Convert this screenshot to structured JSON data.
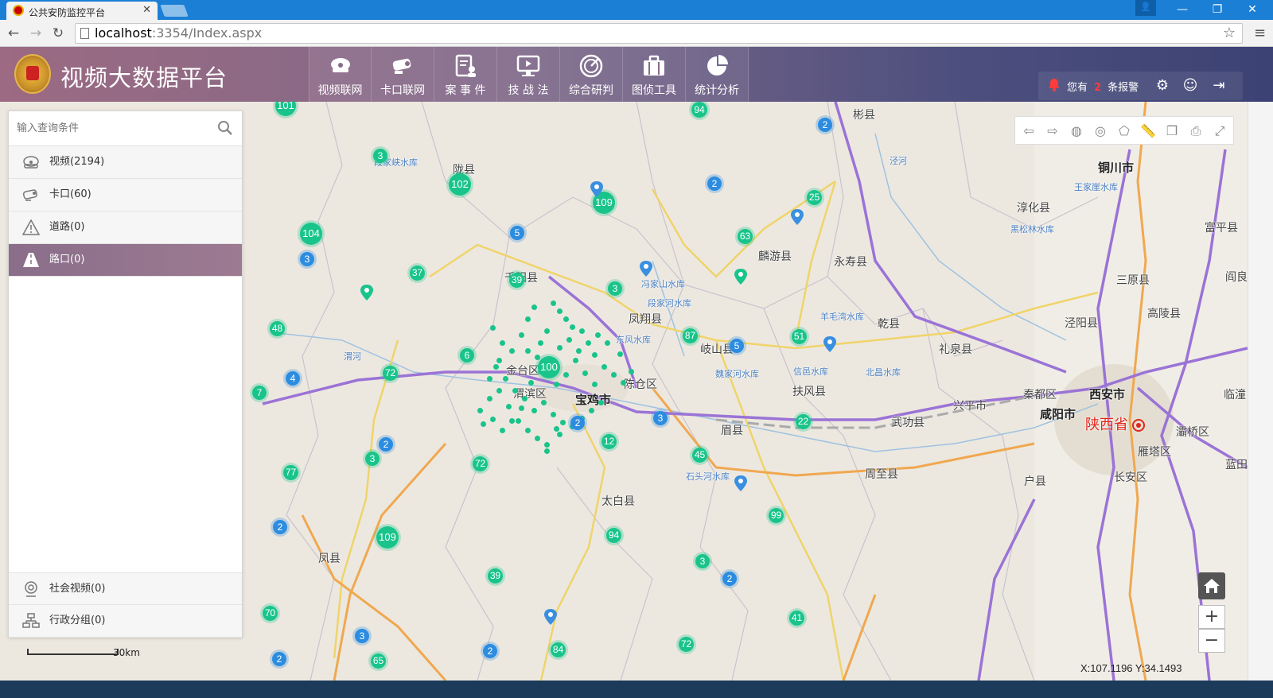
{
  "browser": {
    "tab_title": "公共安防监控平台",
    "url_host": "localhost",
    "url_rest": ":3354/Index.aspx"
  },
  "app": {
    "title": "视频大数据平台",
    "nav": [
      {
        "label": "视频联网",
        "icon": "camera-dome-icon"
      },
      {
        "label": "卡口联网",
        "icon": "bullet-camera-icon"
      },
      {
        "label": "案 事 件",
        "icon": "case-file-icon"
      },
      {
        "label": "技 战 法",
        "icon": "monitor-icon"
      },
      {
        "label": "综合研判",
        "icon": "target-icon"
      },
      {
        "label": "图侦工具",
        "icon": "briefcase-icon"
      },
      {
        "label": "统计分析",
        "icon": "pie-chart-icon"
      }
    ],
    "alert": {
      "prefix": "您有",
      "count": "2",
      "suffix": "条报警"
    }
  },
  "panel": {
    "search_placeholder": "输入查询条件",
    "items": [
      {
        "label": "视频(2194)",
        "icon": "camera-dome-icon"
      },
      {
        "label": "卡口(60)",
        "icon": "bullet-camera-icon"
      },
      {
        "label": "道路(0)",
        "icon": "road-warning-icon"
      },
      {
        "label": "路口(0)",
        "icon": "intersection-icon",
        "active": true
      }
    ],
    "bottom_items": [
      {
        "label": "社会视频(0)",
        "icon": "social-camera-icon"
      },
      {
        "label": "行政分组(0)",
        "icon": "org-tree-icon"
      }
    ]
  },
  "map": {
    "scale_label": "30km",
    "coords": "X:107.1196 Y:34.1493",
    "province_label": "陕西省",
    "place_labels": [
      "陇县",
      "千阳县",
      "宝鸡市",
      "金台区",
      "渭滨区",
      "陈仓区",
      "凤翔县",
      "岐山县",
      "扶风县",
      "眉县",
      "太白县",
      "凤县",
      "麟游县",
      "永寿县",
      "乾县",
      "礼泉县",
      "兴平市",
      "武功县",
      "周至县",
      "户县",
      "长安区",
      "雁塔区",
      "灞桥区",
      "西安市",
      "咸阳市",
      "泾阳县",
      "三原县",
      "高陵县",
      "淳化县",
      "铜川市",
      "富平县",
      "彬县",
      "秦都区",
      "阎良",
      "临潼",
      "蓝田"
    ],
    "water_labels": [
      "段家峡水库",
      "王家崖水库",
      "冯家山水库",
      "东风水库",
      "段家河水库",
      "魏家河水库",
      "信邑水库",
      "北昌水库",
      "羊毛湾水库",
      "黑松林水库",
      "渭河",
      "泾河",
      "石头河水库"
    ],
    "clusters": [
      "101",
      "94",
      "2",
      "3",
      "102",
      "109",
      "2",
      "25",
      "104",
      "5",
      "63",
      "3",
      "37",
      "39",
      "3",
      "48",
      "87",
      "5",
      "51",
      "6",
      "100",
      "72",
      "4",
      "7",
      "2",
      "3",
      "22",
      "12",
      "2",
      "3",
      "45",
      "77",
      "72",
      "2",
      "109",
      "94",
      "99",
      "3",
      "2",
      "39",
      "70",
      "41",
      "3",
      "84",
      "72",
      "2",
      "65",
      "2"
    ]
  },
  "maptools": [
    "prev-extent-icon",
    "next-extent-icon",
    "camera-tool-icon",
    "circle-select-icon",
    "polygon-select-icon",
    "measure-icon",
    "layers-icon",
    "print-icon",
    "fullscreen-icon"
  ]
}
